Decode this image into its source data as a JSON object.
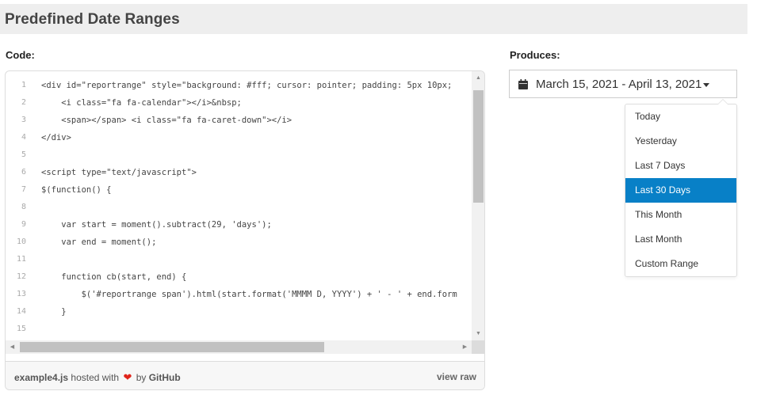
{
  "page": {
    "title": "Predefined Date Ranges"
  },
  "labels": {
    "code": "Code:",
    "produces": "Produces:"
  },
  "code_lines": [
    {
      "n": "1",
      "segs": [
        [
          "c-plain",
          "<div id=\"reportrange\" style=\"background: #fff; cursor: pointer; padding: 5px 10px;"
        ]
      ]
    },
    {
      "n": "2",
      "segs": [
        [
          "c-plain",
          "    <i class=\"fa fa-calendar\"></i>&nbsp;"
        ]
      ]
    },
    {
      "n": "3",
      "segs": [
        [
          "c-plain",
          "    <span></span> <i class=\"fa fa-caret-down\"></i>"
        ]
      ]
    },
    {
      "n": "4",
      "segs": [
        [
          "c-plain",
          "</div>"
        ]
      ]
    },
    {
      "n": "5",
      "segs": []
    },
    {
      "n": "6",
      "segs": [
        [
          "c-plain",
          "<script type=\"text/javascript\">"
        ]
      ]
    },
    {
      "n": "7",
      "segs": [
        [
          "c-plain",
          "$(function() {"
        ]
      ]
    },
    {
      "n": "8",
      "segs": []
    },
    {
      "n": "9",
      "segs": [
        [
          "c-plain",
          "    var start = moment().subtract(29, 'days');"
        ]
      ]
    },
    {
      "n": "10",
      "segs": [
        [
          "c-plain",
          "    var end = moment();"
        ]
      ]
    },
    {
      "n": "11",
      "segs": []
    },
    {
      "n": "12",
      "segs": [
        [
          "c-plain",
          "    function cb(start, end) {"
        ]
      ]
    },
    {
      "n": "13",
      "segs": [
        [
          "c-plain",
          "        $('#reportrange span').html(start.format('MMMM D, YYYY') + ' - ' + end.form"
        ]
      ]
    },
    {
      "n": "14",
      "segs": [
        [
          "c-plain",
          "    }"
        ]
      ]
    },
    {
      "n": "15",
      "segs": []
    }
  ],
  "footer": {
    "file": "example4.js",
    "hosted_with": "hosted with",
    "by": "by",
    "github": "GitHub",
    "view_raw": "view raw"
  },
  "picker": {
    "range_text": "March 15, 2021 - April 13, 2021",
    "ranges": [
      "Today",
      "Yesterday",
      "Last 7 Days",
      "Last 30 Days",
      "This Month",
      "Last Month",
      "Custom Range"
    ],
    "active_index": 3
  },
  "colors": {
    "accent": "#0880c7",
    "heart": "#e0241b",
    "header_bg": "#eeeeee"
  },
  "icons": {
    "calendar": "calendar-icon",
    "caret": "caret-down-icon",
    "heart": "heart-icon"
  }
}
